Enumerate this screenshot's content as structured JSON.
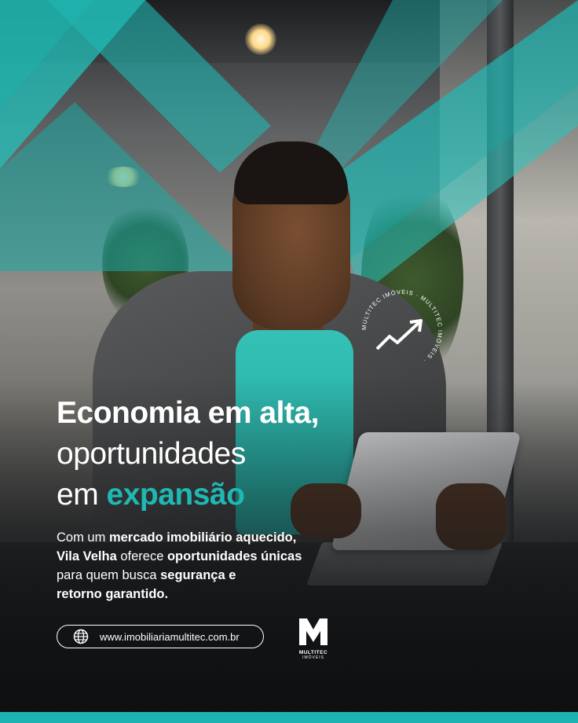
{
  "headline": {
    "line1": "Economia em alta,",
    "line2": "oportunidades",
    "line3_prefix": "em ",
    "line3_accent": "expansão"
  },
  "body": {
    "p1_bold": "Com um ",
    "p1_strong": "mercado imobiliário aquecido,",
    "p2_strong": "Vila Velha",
    "p2_mid": " oferece ",
    "p2_strong2": "oportunidades únicas",
    "p3_text": "para quem busca ",
    "p3_strong": "segurança e",
    "p4_strong": "retorno garantido."
  },
  "website": {
    "url": "www.imobiliariamultitec.com.br",
    "icon": "globe-icon"
  },
  "logo": {
    "mark": "M",
    "name": "MULTITEC",
    "sub": "IMÓVEIS"
  },
  "badge": {
    "ring_text": "MULTITEC IMÓVEIS · MULTITEC IMÓVEIS · ",
    "icon": "trend-up-arrow-icon"
  },
  "colors": {
    "accent": "#1fb8b3",
    "text": "#ffffff"
  }
}
